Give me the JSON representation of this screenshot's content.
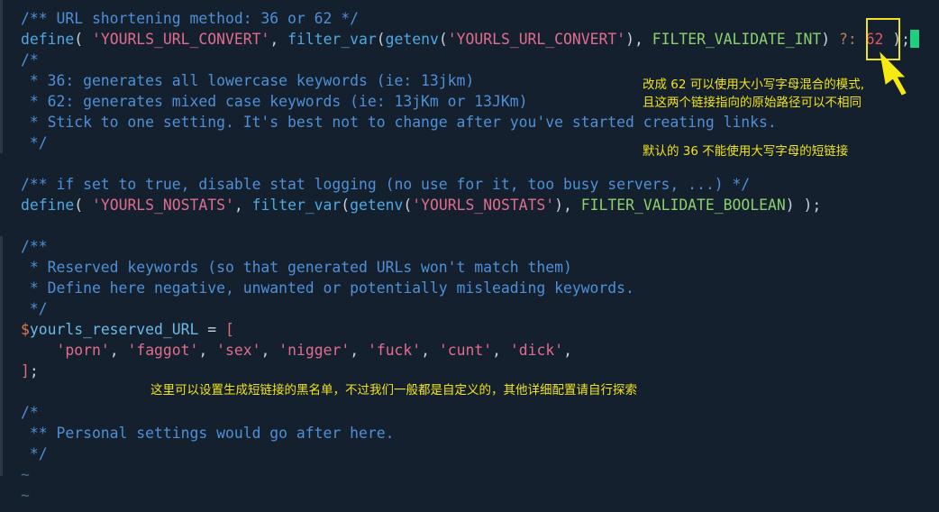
{
  "code_lines": [
    {
      "id": "l1",
      "tokens": [
        {
          "c": "cm",
          "t": "/** URL shortening method: 36 or 62 */"
        }
      ]
    },
    {
      "id": "l2",
      "tokens": [
        {
          "c": "kw",
          "t": "define"
        },
        {
          "c": "pu",
          "t": "( "
        },
        {
          "c": "st",
          "t": "'YOURLS_URL_CONVERT'"
        },
        {
          "c": "pu",
          "t": ", "
        },
        {
          "c": "fn",
          "t": "filter_var"
        },
        {
          "c": "pu",
          "t": "("
        },
        {
          "c": "fn",
          "t": "getenv"
        },
        {
          "c": "pu",
          "t": "("
        },
        {
          "c": "st",
          "t": "'YOURLS_URL_CONVERT'"
        },
        {
          "c": "pu",
          "t": "), "
        },
        {
          "c": "cn",
          "t": "FILTER_VALIDATE_INT"
        },
        {
          "c": "pu",
          "t": ") "
        },
        {
          "c": "op",
          "t": "?: "
        },
        {
          "c": "nm",
          "t": "62"
        },
        {
          "c": "pu",
          "t": " );"
        }
      ]
    },
    {
      "id": "l3",
      "tokens": [
        {
          "c": "cm",
          "t": "/*"
        }
      ]
    },
    {
      "id": "l4",
      "tokens": [
        {
          "c": "cm",
          "t": " * 36: generates all lowercase keywords (ie: 13jkm)"
        }
      ]
    },
    {
      "id": "l5",
      "tokens": [
        {
          "c": "cm",
          "t": " * 62: generates mixed case keywords (ie: 13jKm or 13JKm)"
        }
      ]
    },
    {
      "id": "l6",
      "tokens": [
        {
          "c": "cm",
          "t": " * Stick to one setting. It's best not to change after you've started creating links."
        }
      ]
    },
    {
      "id": "l7",
      "tokens": [
        {
          "c": "cm",
          "t": " */"
        }
      ]
    },
    {
      "id": "l8",
      "tokens": []
    },
    {
      "id": "l9",
      "tokens": [
        {
          "c": "cm",
          "t": "/** if set to true, disable stat logging (no use for it, too busy servers, ...) */"
        }
      ]
    },
    {
      "id": "l10",
      "tokens": [
        {
          "c": "kw",
          "t": "define"
        },
        {
          "c": "pu",
          "t": "( "
        },
        {
          "c": "st",
          "t": "'YOURLS_NOSTATS'"
        },
        {
          "c": "pu",
          "t": ", "
        },
        {
          "c": "fn",
          "t": "filter_var"
        },
        {
          "c": "pu",
          "t": "("
        },
        {
          "c": "fn",
          "t": "getenv"
        },
        {
          "c": "pu",
          "t": "("
        },
        {
          "c": "st",
          "t": "'YOURLS_NOSTATS'"
        },
        {
          "c": "pu",
          "t": "), "
        },
        {
          "c": "cn",
          "t": "FILTER_VALIDATE_BOOLEAN"
        },
        {
          "c": "pu",
          "t": ") );"
        }
      ]
    },
    {
      "id": "l11",
      "tokens": []
    },
    {
      "id": "l12",
      "tokens": [
        {
          "c": "cm",
          "t": "/**"
        }
      ]
    },
    {
      "id": "l13",
      "tokens": [
        {
          "c": "cm",
          "t": " * Reserved keywords (so that generated URLs won't match them)"
        }
      ]
    },
    {
      "id": "l14",
      "tokens": [
        {
          "c": "cm",
          "t": " * Define here negative, unwanted or potentially misleading keywords."
        }
      ]
    },
    {
      "id": "l15",
      "tokens": [
        {
          "c": "cm",
          "t": " */"
        }
      ]
    },
    {
      "id": "l16",
      "tokens": [
        {
          "c": "vd",
          "t": "$"
        },
        {
          "c": "vn",
          "t": "yourls_reserved_URL"
        },
        {
          "c": "pu",
          "t": " = "
        },
        {
          "c": "br",
          "t": "["
        }
      ]
    },
    {
      "id": "l17",
      "tokens": [
        {
          "c": "pu",
          "t": "    "
        },
        {
          "c": "st",
          "t": "'porn'"
        },
        {
          "c": "pu",
          "t": ", "
        },
        {
          "c": "st",
          "t": "'faggot'"
        },
        {
          "c": "pu",
          "t": ", "
        },
        {
          "c": "st",
          "t": "'sex'"
        },
        {
          "c": "pu",
          "t": ", "
        },
        {
          "c": "st",
          "t": "'nigger'"
        },
        {
          "c": "pu",
          "t": ", "
        },
        {
          "c": "st",
          "t": "'fuck'"
        },
        {
          "c": "pu",
          "t": ", "
        },
        {
          "c": "st",
          "t": "'cunt'"
        },
        {
          "c": "pu",
          "t": ", "
        },
        {
          "c": "st",
          "t": "'dick'"
        },
        {
          "c": "pu",
          "t": ","
        }
      ]
    },
    {
      "id": "l18",
      "tokens": [
        {
          "c": "br",
          "t": "]"
        },
        {
          "c": "pu",
          "t": ";"
        }
      ]
    },
    {
      "id": "l19",
      "tokens": []
    },
    {
      "id": "l20",
      "tokens": [
        {
          "c": "cm",
          "t": "/*"
        }
      ]
    },
    {
      "id": "l21",
      "tokens": [
        {
          "c": "cm",
          "t": " ** Personal settings would go after here."
        }
      ]
    },
    {
      "id": "l22",
      "tokens": [
        {
          "c": "cm",
          "t": " */"
        }
      ]
    },
    {
      "id": "l23",
      "tokens": [
        {
          "c": "ti",
          "t": "~"
        }
      ]
    },
    {
      "id": "l24",
      "tokens": [
        {
          "c": "ti",
          "t": "~"
        }
      ]
    }
  ],
  "annotations": {
    "note_62_line1": "改成 62 可以使用大小写字母混合的模式,",
    "note_62_line2": "且这两个链接指向的原始路径可以不相同",
    "note_36": "默认的 36 不能使用大写字母的短链接",
    "note_reserved": "这里可以设置生成短链接的黑名单，不过我们一般都是自定义的，其他详细配置请自行探索"
  },
  "colors": {
    "background": "#14202e",
    "annotation": "#f0e21c",
    "cursor": "#1fcf80"
  },
  "icons": {
    "arrow": "arrow-pointer-icon"
  }
}
